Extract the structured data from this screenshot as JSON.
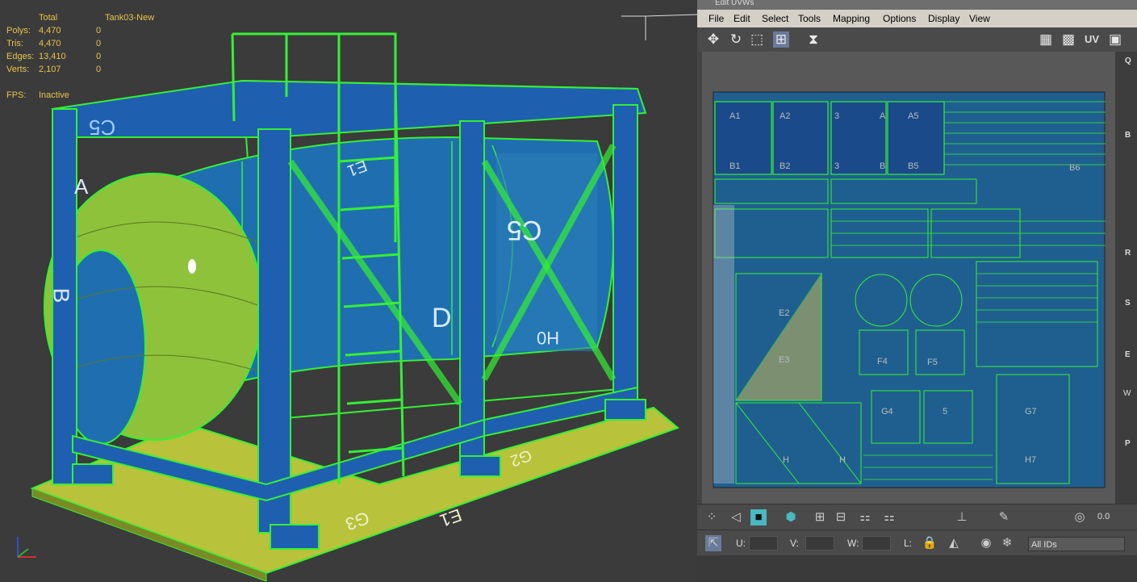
{
  "viewport": {
    "stats": {
      "header_total": "Total",
      "header_object": "Tank03-New",
      "rows": [
        {
          "label": "Polys:",
          "total": "4,470",
          "sel": "0"
        },
        {
          "label": "Tris:",
          "total": "4,470",
          "sel": "0"
        },
        {
          "label": "Edges:",
          "total": "13,410",
          "sel": "0"
        },
        {
          "label": "Verts:",
          "total": "2,107",
          "sel": "0"
        }
      ],
      "fps_label": "FPS:",
      "fps_value": "Inactive"
    },
    "tank_labels": [
      "C5",
      "C5",
      "A",
      "B",
      "D",
      "G2",
      "G3",
      "E1",
      "H0",
      "E1"
    ]
  },
  "uv_editor": {
    "title": "Edit UVWs",
    "menu": [
      "File",
      "Edit",
      "Select",
      "Tools",
      "Mapping",
      "Options",
      "Display",
      "View"
    ],
    "toolbar_uv_label": "UV",
    "canvas_labels": [
      "A1",
      "A2",
      "3",
      "A",
      "A5",
      "B1",
      "B2",
      "3",
      "B",
      "B5",
      "B6",
      "E2",
      "E3",
      "F4",
      "F5",
      "G4",
      "5",
      "G7",
      "H7",
      "H",
      "H"
    ],
    "panel_labels": [
      "Q",
      "B",
      "R",
      "S",
      "E",
      "P"
    ],
    "panel_sublabel": "W",
    "bottom": {
      "zoom_value": "0.0",
      "u_label": "U:",
      "v_label": "V:",
      "w_label": "W:",
      "l_label": "L:",
      "id_dropdown": "All IDs"
    },
    "colors": {
      "wire": "#2ee82e",
      "fill_blue": "#1f5fa0",
      "fill_teal": "#2a8a8a"
    }
  }
}
